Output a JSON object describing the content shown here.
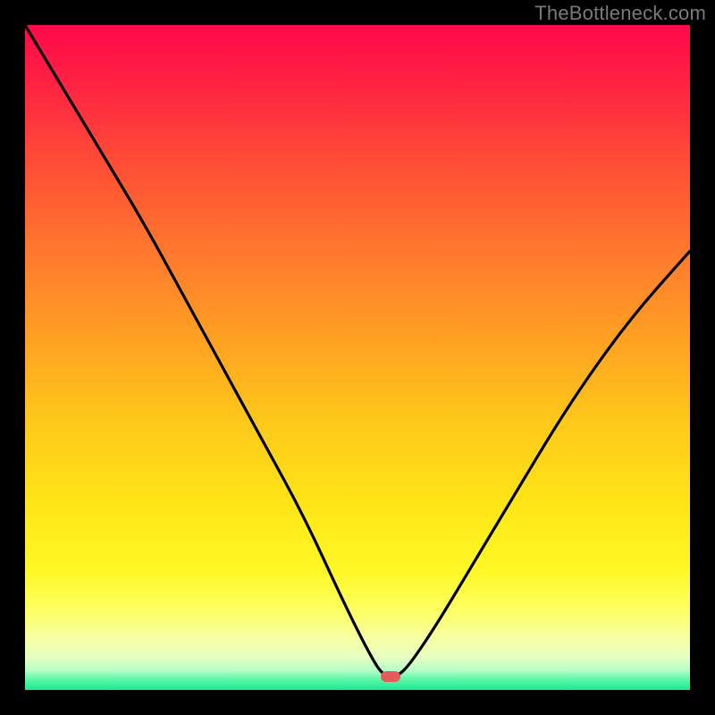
{
  "watermark": {
    "text": "TheBottleneck.com"
  },
  "colors": {
    "background": "#000000",
    "curve": "#000000",
    "marker": "#e55a5a",
    "gradient_top": "#ff0b46",
    "gradient_bottom": "#1fe58f"
  },
  "chart_data": {
    "type": "line",
    "title": "",
    "xlabel": "",
    "ylabel": "",
    "xlim": [
      0,
      100
    ],
    "ylim": [
      0,
      100
    ],
    "grid": false,
    "legend": false,
    "annotations": [
      {
        "name": "marker",
        "x": 55,
        "y": 2,
        "shape": "rounded-rect",
        "color": "#e55a5a"
      }
    ],
    "background_gradient": {
      "direction": "vertical",
      "stops": [
        {
          "pos": 0.0,
          "color": "#ff0b46"
        },
        {
          "pos": 0.22,
          "color": "#ff5135"
        },
        {
          "pos": 0.48,
          "color": "#ffa321"
        },
        {
          "pos": 0.72,
          "color": "#ffe516"
        },
        {
          "pos": 0.88,
          "color": "#fdff62"
        },
        {
          "pos": 0.95,
          "color": "#e7ffc0"
        },
        {
          "pos": 1.0,
          "color": "#1fe58f"
        }
      ]
    },
    "series": [
      {
        "name": "bottleneck-curve",
        "x": [
          0,
          6,
          12,
          18,
          24,
          30,
          36,
          42,
          48,
          52,
          54,
          56,
          58,
          62,
          68,
          74,
          80,
          86,
          92,
          100
        ],
        "y": [
          100,
          90,
          80,
          70,
          59,
          48,
          37,
          26,
          13,
          5,
          2,
          2,
          4,
          10,
          20,
          30,
          40,
          49,
          57,
          66
        ]
      }
    ]
  }
}
